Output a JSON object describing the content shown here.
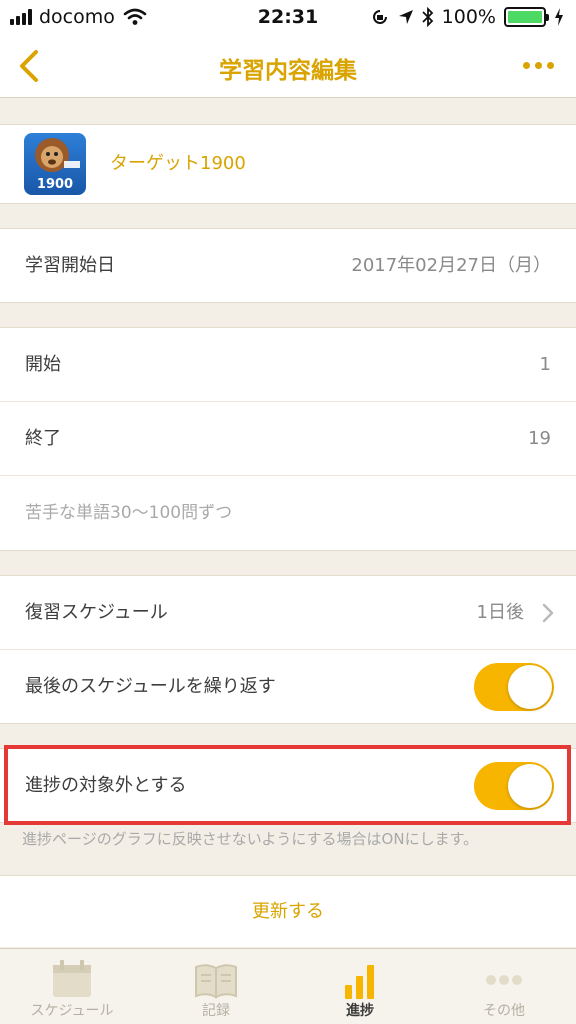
{
  "status_bar": {
    "carrier": "docomo",
    "time": "22:31",
    "battery": "100%"
  },
  "nav": {
    "title": "学習内容編集"
  },
  "book": {
    "title": "ターゲット1900",
    "icon_text": "1900"
  },
  "start_date": {
    "label": "学習開始日",
    "value": "2017年02月27日（月）"
  },
  "range": {
    "start_label": "開始",
    "start_value": "1",
    "end_label": "終了",
    "end_value": "19",
    "memo": "苦手な単語30〜100問ずつ"
  },
  "review": {
    "label": "復習スケジュール",
    "value": "1日後",
    "repeat_label": "最後のスケジュールを繰り返す",
    "repeat_on": true
  },
  "exclude": {
    "label": "進捗の対象外とする",
    "on": true,
    "note": "進捗ページのグラフに反映させないようにする場合はONにします。"
  },
  "update_button": "更新する",
  "tabs": [
    {
      "label": "スケジュール",
      "icon": "calendar-icon",
      "active": false
    },
    {
      "label": "記録",
      "icon": "open-book-icon",
      "active": false
    },
    {
      "label": "進捗",
      "icon": "bar-chart-icon",
      "active": true
    },
    {
      "label": "その他",
      "icon": "more-icon",
      "active": false
    }
  ],
  "colors": {
    "accent": "#d9a300",
    "toggle_on": "#f7b500",
    "highlight_border": "#e53935",
    "background": "#f3efe6"
  }
}
